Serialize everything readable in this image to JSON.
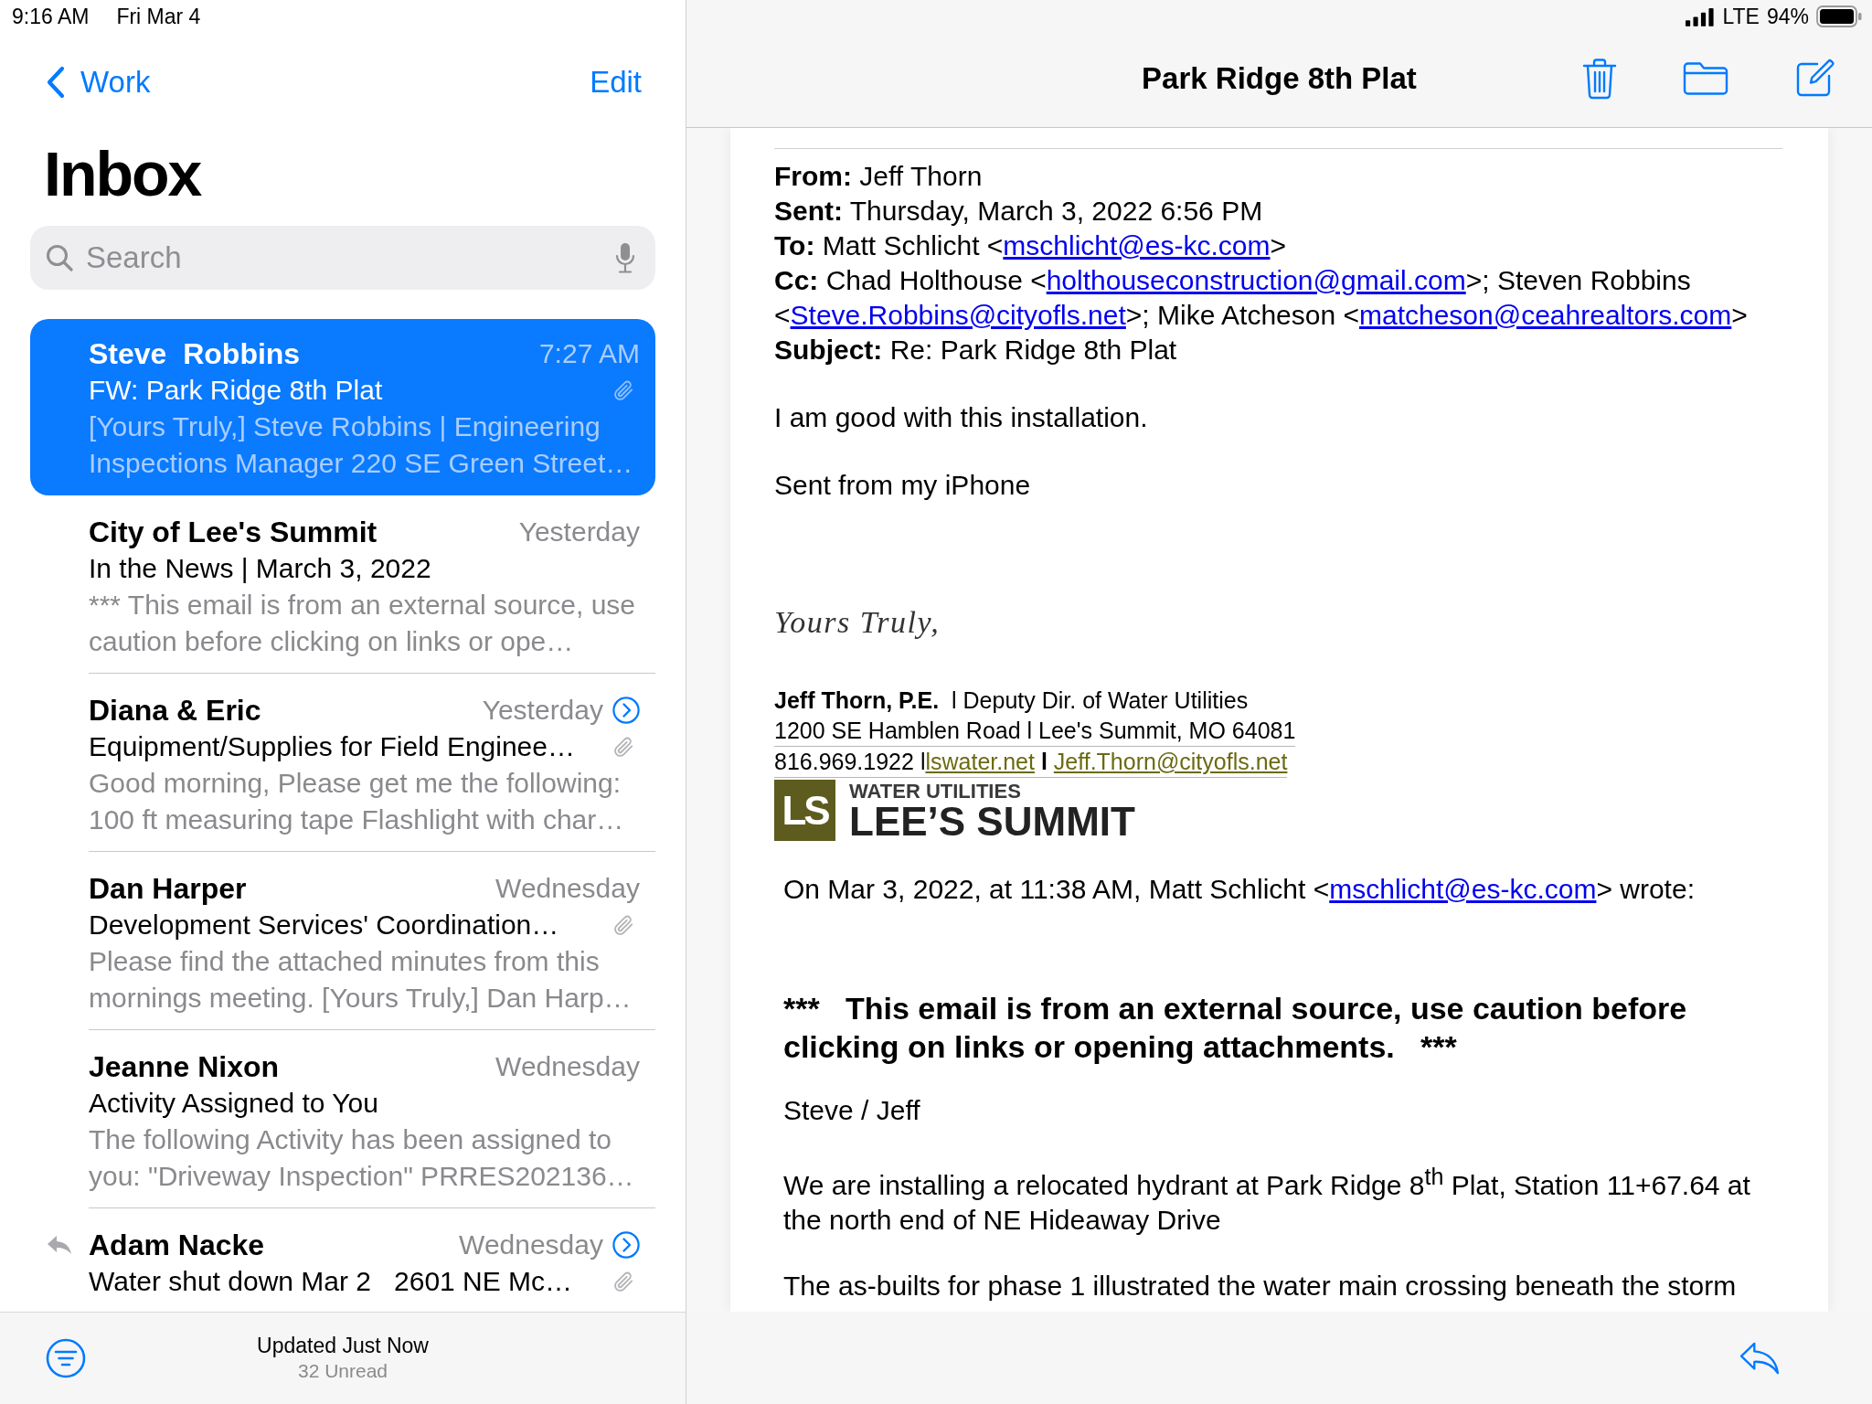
{
  "status_bar": {
    "time": "9:16 AM",
    "date": "Fri Mar 4",
    "network": "LTE",
    "battery": "94%"
  },
  "nav": {
    "back": "Work",
    "action": "Edit"
  },
  "title": "Inbox",
  "search": {
    "placeholder": "Search"
  },
  "messages": [
    {
      "sender": "Steve  Robbins",
      "time": "7:27 AM",
      "subject": "FW: Park Ridge 8th Plat",
      "preview": "[Yours Truly,] Steve Robbins | Engineering Inspections Manager 220 SE Green Street…",
      "selected": true,
      "thread": false,
      "attachment": true,
      "replied": false
    },
    {
      "sender": "City of Lee's Summit",
      "time": "Yesterday",
      "subject": "In the News | March 3, 2022",
      "preview": "*** This email is from an external source, use caution before clicking on links or ope…",
      "selected": false,
      "thread": false,
      "attachment": false,
      "replied": false
    },
    {
      "sender": "Diana & Eric",
      "time": "Yesterday",
      "subject": "Equipment/Supplies for Field Enginee…",
      "preview": "Good morning, Please get me the following: 100 ft measuring tape Flashlight with char…",
      "selected": false,
      "thread": true,
      "attachment": true,
      "replied": false
    },
    {
      "sender": "Dan Harper",
      "time": "Wednesday",
      "subject": "Development Services' Coordination…",
      "preview": "Please find the attached minutes from this mornings meeting. [Yours Truly,] Dan Harp…",
      "selected": false,
      "thread": false,
      "attachment": true,
      "replied": false
    },
    {
      "sender": "Jeanne Nixon",
      "time": "Wednesday",
      "subject": "Activity Assigned to You",
      "preview": "The following Activity has been assigned to you: \"Driveway Inspection\" PRRES202136…",
      "selected": false,
      "thread": false,
      "attachment": false,
      "replied": false
    },
    {
      "sender": "Adam Nacke",
      "time": "Wednesday",
      "subject": "Water shut down Mar 2   2601 NE Mc…",
      "selected": false,
      "thread": true,
      "attachment": true,
      "replied": true
    }
  ],
  "toolbar": {
    "status": "Updated Just Now",
    "unread": "32 Unread"
  },
  "detail": {
    "title": "Park Ridge 8th Plat",
    "headers": [
      {
        "parts": [
          {
            "kind": "text",
            "text": "**From:** Jeff Thorn"
          }
        ]
      },
      {
        "parts": [
          {
            "kind": "text",
            "text": "**Sent:** Thursday, March 3, 2022 6:56 PM"
          }
        ]
      },
      {
        "parts": [
          {
            "kind": "text",
            "text": "**To:** Matt Schlicht <"
          },
          {
            "kind": "email",
            "text": "mschlicht@es-kc.com"
          },
          {
            "kind": "text",
            "text": ">"
          }
        ]
      },
      {
        "parts": [
          {
            "kind": "text",
            "text": "**Cc:** Chad Holthouse <"
          },
          {
            "kind": "email",
            "text": "holthouseconstruction@gmail.com"
          },
          {
            "kind": "text",
            "text": ">; Steven Robbins <"
          },
          {
            "kind": "email",
            "text": "Steve.Robbins@cityofls.net"
          },
          {
            "kind": "text",
            "text": ">; Mike Atcheson <"
          },
          {
            "kind": "email",
            "text": "matcheson@ceahrealtors.com"
          },
          {
            "kind": "text",
            "text": ">"
          }
        ]
      },
      {
        "parts": [
          {
            "kind": "text",
            "text": "**Subject:** Re: Park Ridge 8th Plat"
          }
        ]
      }
    ],
    "body": [
      {
        "parts": [
          {
            "kind": "text",
            "text": "I am good with this installation."
          }
        ]
      },
      {
        "parts": [
          {
            "kind": "text",
            "text": "Sent from my iPhone"
          }
        ]
      }
    ],
    "signature": {
      "script": "Yours Truly,",
      "lines": [
        {
          "ruled": false,
          "parts": [
            {
              "kind": "text",
              "text": "**Jeff Thorn, P.E.**  l Deputy Dir. of Water Utilities"
            }
          ]
        },
        {
          "ruled": true,
          "parts": [
            {
              "kind": "text",
              "text": "1200 SE Hamblen Road l Lee's Summit, MO 64081"
            }
          ]
        },
        {
          "ruled": true,
          "parts": [
            {
              "kind": "text",
              "text": "816.969.1922 l"
            },
            {
              "kind": "url",
              "text": "lswater.net"
            },
            {
              "kind": "text",
              "text": " **l** "
            },
            {
              "kind": "email",
              "text": "Jeff.Thorn@cityofls.net"
            }
          ]
        }
      ],
      "logo": {
        "badge": "LS",
        "subtitle": "WATER UTILITIES",
        "name": "LEE’S SUMMIT"
      }
    },
    "quoted": [
      {
        "kind": "para",
        "parts": [
          {
            "kind": "text",
            "text": "On Mar 3, 2022, at 11:38 AM, Matt Schlicht <"
          },
          {
            "kind": "email",
            "text": "mschlicht@es-kc.com"
          },
          {
            "kind": "text",
            "text": "> wrote:"
          }
        ]
      },
      {
        "kind": "warning",
        "parts": [
          {
            "kind": "plain",
            "text": "***   This email is from an external source, use caution before clicking on links or opening attachments.   ***"
          }
        ]
      },
      {
        "kind": "para",
        "parts": [
          {
            "kind": "text",
            "text": "Steve / Jeff"
          }
        ]
      },
      {
        "kind": "para",
        "parts": [
          {
            "kind": "text",
            "text": "We are installing a relocated hydrant at Park Ridge 8$^{th}$ Plat, Station 11+67.64 at the north end of NE Hideaway Drive"
          }
        ]
      },
      {
        "kind": "para",
        "parts": [
          {
            "kind": "text",
            "text": "The as-builts for phase 1 illustrated the water main crossing beneath the storm"
          }
        ]
      }
    ]
  }
}
